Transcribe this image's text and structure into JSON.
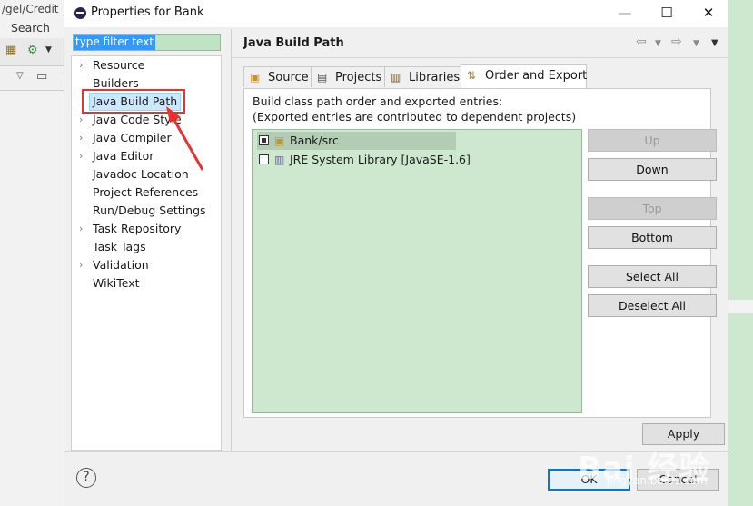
{
  "background": {
    "path_text": "/gel/Credit_",
    "search_menu": "Search"
  },
  "window": {
    "title": "Properties for Bank",
    "minimize": "—",
    "maximize": "☐",
    "close": "✕"
  },
  "filter": {
    "value": "type filter text"
  },
  "tree": {
    "items": [
      {
        "label": "Resource",
        "expandable": true
      },
      {
        "label": "Builders",
        "expandable": false
      },
      {
        "label": "Java Build Path",
        "expandable": false,
        "selected": true
      },
      {
        "label": "Java Code Style",
        "expandable": true
      },
      {
        "label": "Java Compiler",
        "expandable": true
      },
      {
        "label": "Java Editor",
        "expandable": true
      },
      {
        "label": "Javadoc Location",
        "expandable": false
      },
      {
        "label": "Project References",
        "expandable": false
      },
      {
        "label": "Run/Debug Settings",
        "expandable": false
      },
      {
        "label": "Task Repository",
        "expandable": true
      },
      {
        "label": "Task Tags",
        "expandable": false
      },
      {
        "label": "Validation",
        "expandable": true
      },
      {
        "label": "WikiText",
        "expandable": false
      }
    ]
  },
  "page": {
    "title": "Java Build Path"
  },
  "tabs": [
    {
      "label": "Source",
      "icon": "source-folder-icon"
    },
    {
      "label": "Projects",
      "icon": "projects-icon"
    },
    {
      "label": "Libraries",
      "icon": "libraries-icon"
    },
    {
      "label": "Order and Export",
      "icon": "order-export-icon",
      "active": true
    }
  ],
  "order_export": {
    "description_line1": "Build class path order and exported entries:",
    "description_line2": "(Exported entries are contributed to dependent projects)",
    "entries": [
      {
        "label": "Bank/src",
        "checked": true,
        "selected": true
      },
      {
        "label": "JRE System Library [JavaSE-1.6]",
        "checked": false,
        "selected": false
      }
    ]
  },
  "side_buttons": {
    "up": "Up",
    "down": "Down",
    "top": "Top",
    "bottom": "Bottom",
    "select_all": "Select All",
    "deselect_all": "Deselect All"
  },
  "footer": {
    "apply": "Apply",
    "ok": "OK",
    "cancel": "Cancel",
    "help": "?"
  },
  "watermark": {
    "text": "Bai 经验",
    "sub": "jingyan.baidu.com"
  },
  "colors": {
    "accent": "#0078d7",
    "annotation_red": "#e8322f",
    "list_bg": "#cde8cf"
  }
}
